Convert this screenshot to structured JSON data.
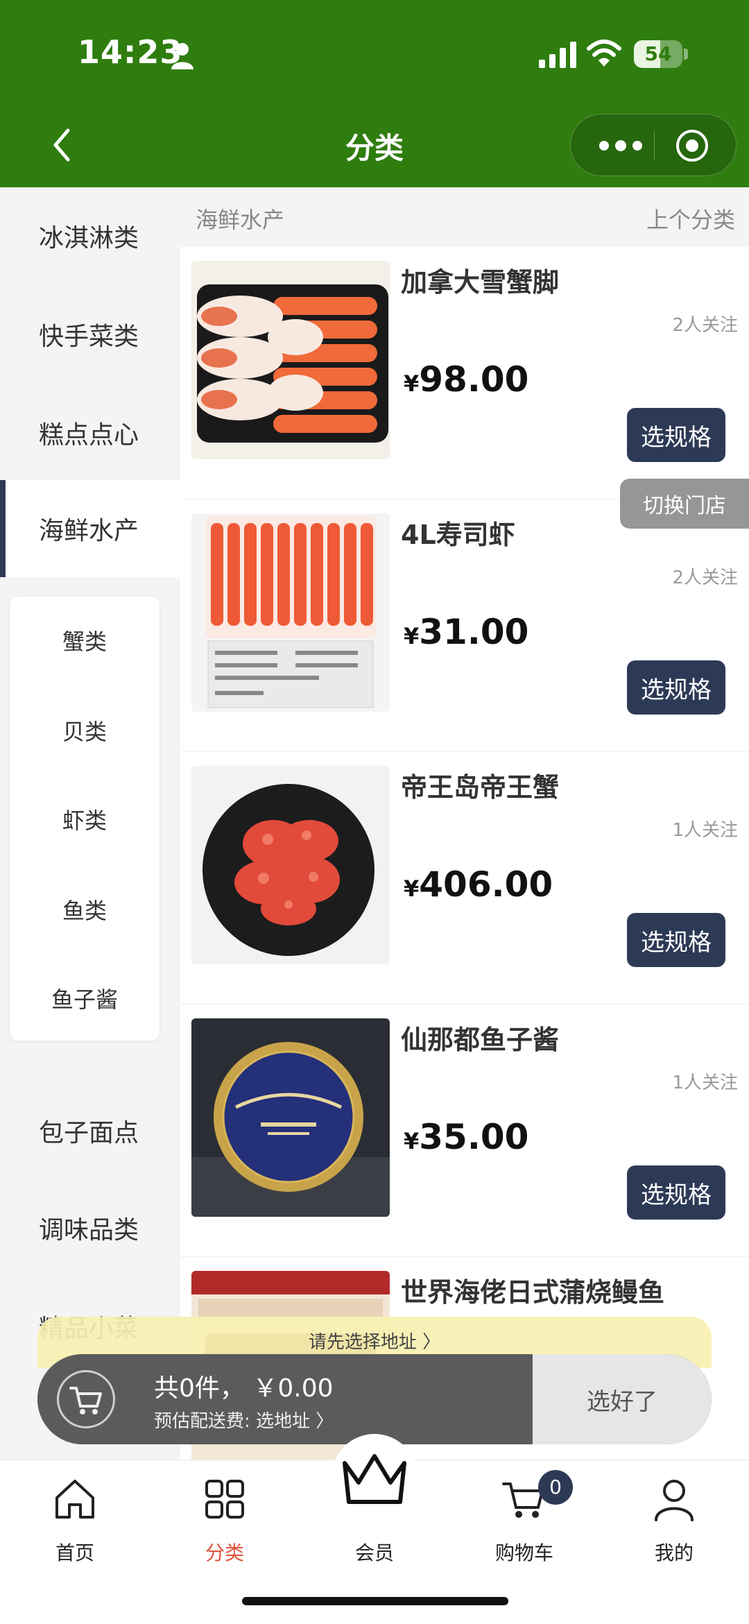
{
  "status_bar": {
    "time": "14:23",
    "battery": "54",
    "battery_level": 0.54
  },
  "header": {
    "title": "分类"
  },
  "sidebar": {
    "categories": [
      {
        "label": "冰淇淋类"
      },
      {
        "label": "快手菜类"
      },
      {
        "label": "糕点点心"
      },
      {
        "label": "海鲜水产"
      },
      {
        "label": "包子面点"
      },
      {
        "label": "调味品类"
      },
      {
        "label": "精品小菜"
      }
    ],
    "active_category": "海鲜水产",
    "subcategories": [
      {
        "label": "蟹类"
      },
      {
        "label": "贝类"
      },
      {
        "label": "虾类"
      },
      {
        "label": "鱼类"
      },
      {
        "label": "鱼子酱"
      }
    ]
  },
  "content": {
    "breadcrumb": "海鲜水产",
    "prev_category": "上个分类",
    "currency": "¥",
    "spec_label": "选规格",
    "products": [
      {
        "name": "加拿大雪蟹脚",
        "followers": "2人关注",
        "price": "98.00"
      },
      {
        "name": "4L寿司虾",
        "followers": "2人关注",
        "price": "31.00"
      },
      {
        "name": "帝王岛帝王蟹",
        "followers": "1人关注",
        "price": "406.00"
      },
      {
        "name": "仙那都鱼子酱",
        "followers": "1人关注",
        "price": "35.00"
      },
      {
        "name": "世界海佬日式蒲烧鳗鱼",
        "followers": "",
        "price": ""
      }
    ],
    "switch_store": "切换门店"
  },
  "cart": {
    "address_prompt": "请先选择地址 〉",
    "total": "共0件， ￥0.00",
    "delivery": "预估配送费: 选地址 〉",
    "confirm": "选好了"
  },
  "tabbar": {
    "tabs": [
      {
        "label": "首页",
        "icon": "home-icon"
      },
      {
        "label": "分类",
        "icon": "grid-icon"
      },
      {
        "label": "会员",
        "icon": "crown-icon"
      },
      {
        "label": "购物车",
        "icon": "cart-icon"
      },
      {
        "label": "我的",
        "icon": "user-icon"
      }
    ],
    "cart_count": "0"
  },
  "colors": {
    "header_green": "#2f7d0f",
    "accent_navy": "#2d3a56",
    "active_tab": "#e0533d"
  }
}
